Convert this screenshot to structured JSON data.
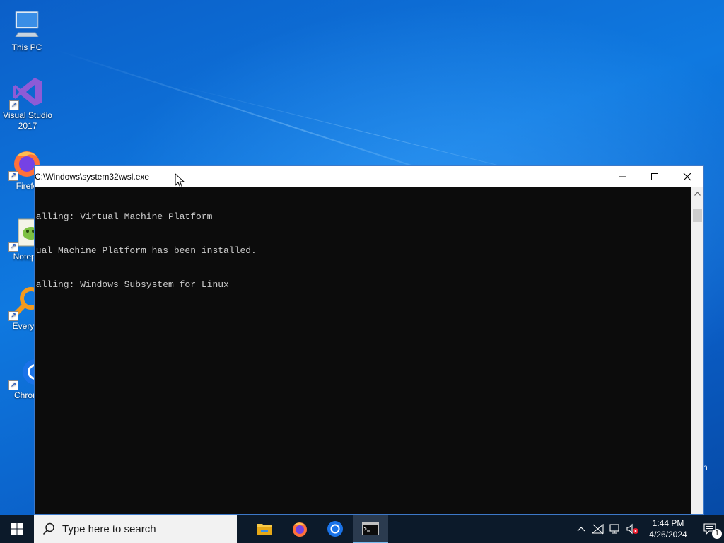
{
  "desktop": {
    "icons": [
      {
        "label": "This PC",
        "icon": "this-pc-icon",
        "shortcut": false
      },
      {
        "label": "Visual Studio 2017",
        "icon": "visual-studio-icon",
        "shortcut": true
      },
      {
        "label": "Firefo",
        "icon": "firefox-icon",
        "shortcut": true
      },
      {
        "label": "Notepa",
        "icon": "notepad-plus-plus-icon",
        "shortcut": true
      },
      {
        "label": "Everyth",
        "icon": "everything-search-icon",
        "shortcut": true
      },
      {
        "label": "Chrom",
        "icon": "chrome-icon",
        "shortcut": true
      }
    ],
    "partial_label_right": "n"
  },
  "window": {
    "title": "C:\\Windows\\system32\\wsl.exe",
    "console_lines": [
      "talling: Virtual Machine Platform",
      "tual Machine Platform has been installed.",
      "talling: Windows Subsystem for Linux"
    ],
    "background_color": "#0c0c0c",
    "text_color": "#cccccc"
  },
  "taskbar": {
    "search_placeholder": "Type here to search",
    "apps": [
      {
        "name": "file-explorer",
        "icon": "folder-icon"
      },
      {
        "name": "firefox",
        "icon": "firefox-icon"
      },
      {
        "name": "chrome",
        "icon": "chrome-icon"
      },
      {
        "name": "console",
        "icon": "console-icon",
        "active": true
      }
    ],
    "clock": {
      "time": "1:44 PM",
      "date": "4/26/2024"
    },
    "notification_count": "1"
  }
}
